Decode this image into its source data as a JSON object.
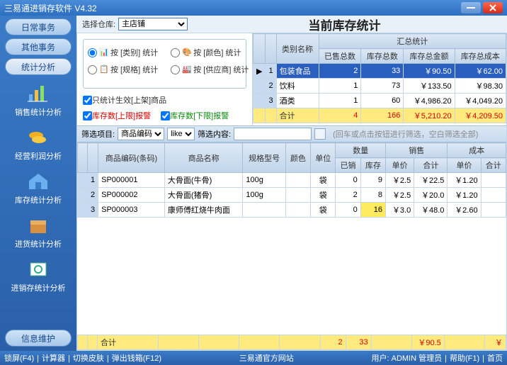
{
  "app": {
    "title": "三易通进销存软件  V4.32"
  },
  "toolbar": {
    "warehouse_label": "选择仓库:",
    "warehouse_selected": "主店铺",
    "page_title": "当前库存统计"
  },
  "stat_options": {
    "by_category": "按 [类别] 统计",
    "by_color": "按 [颜色] 统计",
    "by_spec": "按 [规格] 统计",
    "by_supplier": "按 [供应商] 统计",
    "only_onshelf": "只统计生效[上架]商品",
    "alarm_upper": "库存数[上限]报警",
    "alarm_lower": "库存数[下限]报警"
  },
  "top_headers": {
    "cat_name": "类别名称",
    "summary": "汇总统计",
    "sold_total": "已售总数",
    "stock_total": "库存总数",
    "stock_amount": "库存总金额",
    "stock_cost": "库存总成本"
  },
  "top_rows": [
    {
      "idx": "1",
      "name": "包装食品",
      "sold": "2",
      "stock": "33",
      "amount": "￥90.50",
      "cost": "￥62.00",
      "sel": true
    },
    {
      "idx": "2",
      "name": "饮料",
      "sold": "1",
      "stock": "73",
      "amount": "￥133.50",
      "cost": "￥98.30"
    },
    {
      "idx": "3",
      "name": "酒类",
      "sold": "1",
      "stock": "60",
      "amount": "￥4,986.20",
      "cost": "￥4,049.20"
    }
  ],
  "top_sum": {
    "label": "合计",
    "sold": "4",
    "stock": "166",
    "amount": "￥5,210.20",
    "cost": "￥4,209.50"
  },
  "filter": {
    "label": "筛选项目:",
    "col_selected": "商品编码",
    "op_selected": "like",
    "content_label": "筛选内容:",
    "hint": "(回车或点击按钮进行筛选，空白筛选全部)"
  },
  "low_headers": {
    "code": "商品编码(条码)",
    "name": "商品名称",
    "spec": "规格型号",
    "color": "颜色",
    "unit": "单位",
    "qty": "数量",
    "sold": "已销",
    "stock": "库存",
    "sales": "销售",
    "s_price": "单价",
    "s_sum": "合计",
    "cost": "成本",
    "c_price": "单价",
    "c_sum": "合计"
  },
  "low_rows": [
    {
      "idx": "1",
      "code": "SP000001",
      "name": "大骨面(牛骨)",
      "spec": "100g",
      "color": "",
      "unit": "袋",
      "sold": "0",
      "stock": "9",
      "sprice": "￥2.5",
      "ssum": "￥22.5",
      "cprice": "￥1.20",
      "csum": ""
    },
    {
      "idx": "2",
      "code": "SP000002",
      "name": "大骨面(猪骨)",
      "spec": "100g",
      "color": "",
      "unit": "袋",
      "sold": "2",
      "stock": "8",
      "sprice": "￥2.5",
      "ssum": "￥20.0",
      "cprice": "￥1.20",
      "csum": ""
    },
    {
      "idx": "3",
      "code": "SP000003",
      "name": "康师傅红烧牛肉面",
      "spec": "",
      "color": "",
      "unit": "袋",
      "sold": "0",
      "stock": "16",
      "stock_hl": true,
      "sprice": "￥3.0",
      "ssum": "￥48.0",
      "cprice": "￥2.60",
      "csum": ""
    }
  ],
  "low_sum": {
    "label": "合计",
    "sold": "2",
    "stock": "33",
    "ssum": "￥90.5",
    "csum": "￥"
  },
  "sidebar": {
    "pills": [
      "日常事务",
      "其他事务",
      "统计分析"
    ],
    "items": [
      {
        "label": "销售统计分析"
      },
      {
        "label": "经营利润分析"
      },
      {
        "label": "库存统计分析"
      },
      {
        "label": "进货统计分析"
      },
      {
        "label": "进销存统计分析"
      }
    ],
    "bottom": "信息维护"
  },
  "status": {
    "left": [
      "锁屏(F4)",
      "计算器",
      "切换皮肤",
      "弹出钱箱(F12)"
    ],
    "center": "三易通官方网站",
    "right": [
      "用户:  ADMIN 管理员",
      "帮助(F1)",
      "首页"
    ]
  },
  "chart_data": null
}
